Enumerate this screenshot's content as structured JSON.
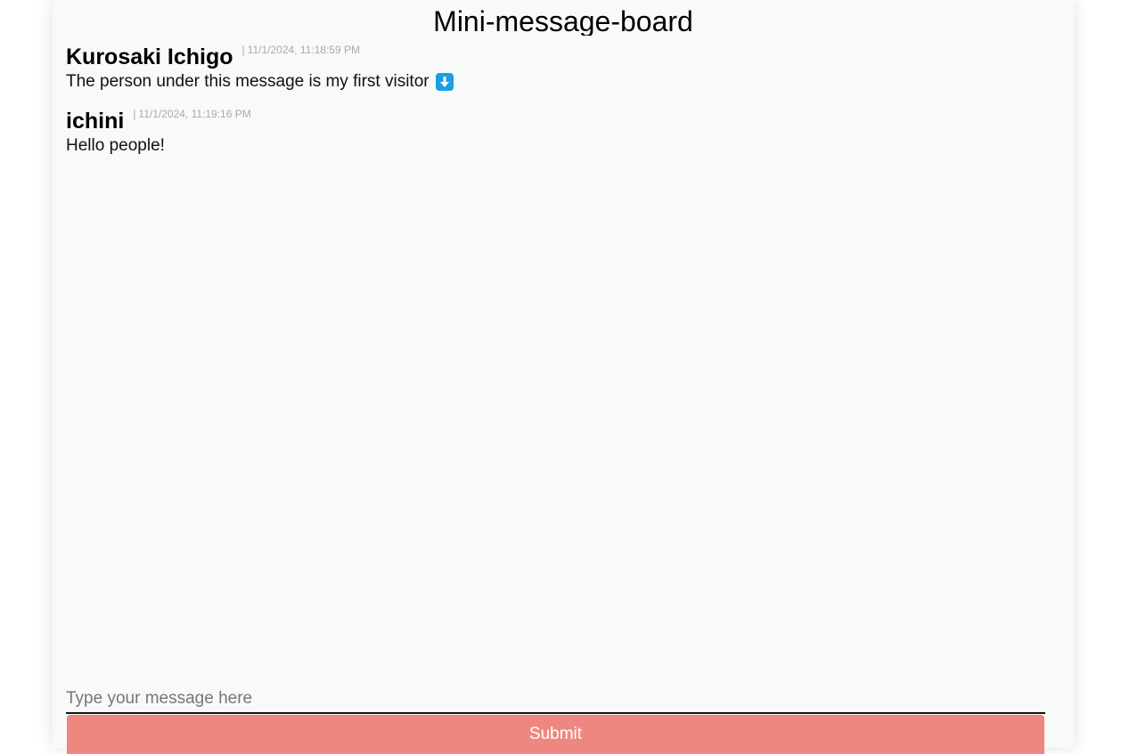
{
  "page": {
    "title": "Mini-message-board"
  },
  "messages": [
    {
      "author": "Kurosaki Ichigo",
      "separator": "|",
      "timestamp": "11/1/2024, 11:18:59 PM",
      "text": "The person under this message is my first visitor",
      "emoji": "down-arrow-icon"
    },
    {
      "author": "ichini",
      "separator": "|",
      "timestamp": "11/1/2024, 11:19:16 PM",
      "text": "Hello people!"
    }
  ],
  "form": {
    "placeholder": "Type your message here",
    "value": "",
    "submit_label": "Submit"
  },
  "colors": {
    "card_background": "#f8f9f9",
    "submit_button": "#ee877f",
    "emoji_background": "#1b9ee3",
    "timestamp_text": "#aaaaaa"
  }
}
